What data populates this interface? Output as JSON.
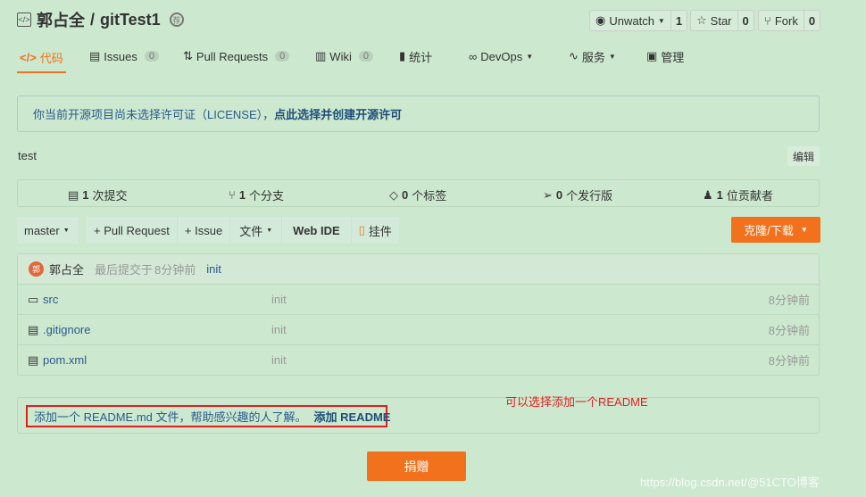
{
  "repo": {
    "owner": "郭占全",
    "separator": "/",
    "name": "gitTest1"
  },
  "actions": {
    "watch_label": "Unwatch",
    "watch_count": "1",
    "star_label": "Star",
    "star_count": "0",
    "fork_label": "Fork",
    "fork_count": "0"
  },
  "tabs": [
    {
      "label": "代码"
    },
    {
      "label": "Issues",
      "badge": "0"
    },
    {
      "label": "Pull Requests",
      "badge": "0"
    },
    {
      "label": "Wiki",
      "badge": "0"
    },
    {
      "label": "统计"
    },
    {
      "label": "DevOps"
    },
    {
      "label": "服务"
    },
    {
      "label": "管理"
    }
  ],
  "license_notice": {
    "text": "你当前开源项目尚未选择许可证（LICENSE），",
    "link": "点此选择并创建开源许可"
  },
  "description": "test",
  "edit_label": "编辑",
  "stats": [
    {
      "num": "1",
      "label": "次提交"
    },
    {
      "num": "1",
      "label": "个分支"
    },
    {
      "num": "0",
      "label": "个标签"
    },
    {
      "num": "0",
      "label": "个发行版"
    },
    {
      "num": "1",
      "label": "位贡献者"
    }
  ],
  "toolbar": {
    "branch": "master",
    "pull_request": "+ Pull Request",
    "issue": "+ Issue",
    "files": "文件",
    "web_ide": "Web IDE",
    "widget": "挂件",
    "clone": "克隆/下载"
  },
  "last_commit": {
    "author": "郭占全",
    "prefix": "最后提交于",
    "time": "8分钟前",
    "message": "init"
  },
  "files": [
    {
      "name": "src",
      "message": "init",
      "time": "8分钟前",
      "type": "folder"
    },
    {
      "name": ".gitignore",
      "message": "init",
      "time": "8分钟前",
      "type": "file"
    },
    {
      "name": "pom.xml",
      "message": "init",
      "time": "8分钟前",
      "type": "file"
    }
  ],
  "readme_notice": {
    "text": "添加一个 README.md 文件，帮助感兴趣的人了解。",
    "link": "添加 README"
  },
  "annotation": "可以选择添加一个README",
  "donate_label": "捐赠",
  "watermark": "https://blog.csdn.net/@51CTO博客"
}
